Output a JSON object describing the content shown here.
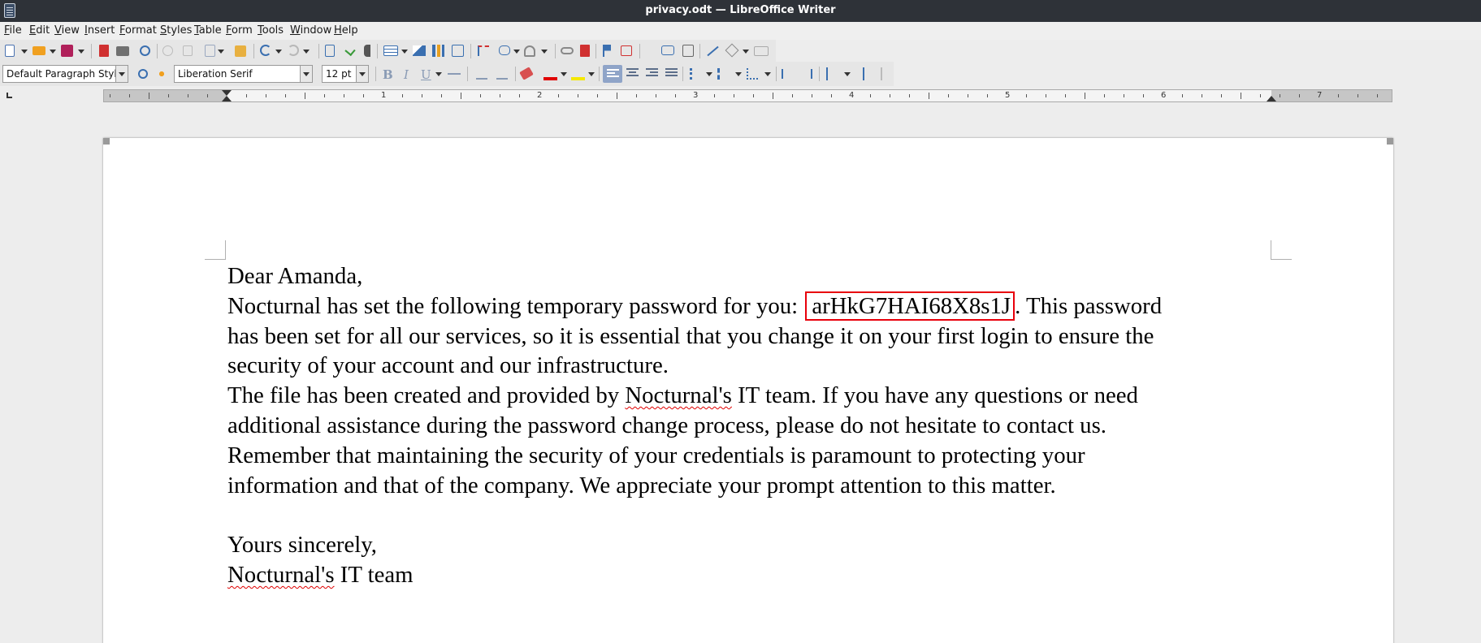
{
  "window": {
    "title": "privacy.odt — LibreOffice Writer"
  },
  "menu": {
    "items": [
      "File",
      "Edit",
      "View",
      "Insert",
      "Format",
      "Styles",
      "Table",
      "Form",
      "Tools",
      "Window",
      "Help"
    ]
  },
  "format_toolbar": {
    "paragraph_style": "Default Paragraph Style",
    "font_name": "Liberation Serif",
    "font_size": "12 pt",
    "bold_label": "B",
    "italic_label": "I",
    "underline_label": "U"
  },
  "ruler": {
    "numbers": [
      "1",
      "2",
      "3",
      "4",
      "5",
      "6",
      "7"
    ]
  },
  "document": {
    "greeting": "Dear Amanda,",
    "p1_before": "Nocturnal has set the following temporary password for you:",
    "password": "arHkG7HAI68X8s1J",
    "p1_after": ". This password",
    "p1_line2": "has been set for all our services, so it is essential that you change it on your first login to ensure the",
    "p1_line3": "security of your account and our infrastructure.",
    "p2_line1_before": "The file has been created and provided by ",
    "p2_line1_word": "Nocturnal's",
    "p2_line1_after": " IT team. If you have any questions or need",
    "p2_line2": "additional assistance during the password change process, please do not hesitate to contact us.",
    "p3_line1": "Remember that maintaining the security of your credentials is paramount to protecting your",
    "p3_line2": "information and that of the company. We appreciate your prompt attention to this matter.",
    "closing": "Yours sincerely,",
    "signature_word": "Nocturnal's",
    "signature_rest": " IT team"
  },
  "colors": {
    "titlebar_bg": "#2e3238",
    "highlight_box": "#e8000b",
    "spellcheck_underline": "#e00000",
    "font_color_swatch": "#e00000",
    "highlight_swatch": "#f5e800"
  },
  "icons": [
    "new-document-icon",
    "open-icon",
    "save-icon",
    "export-pdf-icon",
    "print-icon",
    "print-preview-icon",
    "cut-icon",
    "copy-icon",
    "paste-icon",
    "clone-formatting-icon",
    "undo-icon",
    "redo-icon",
    "find-replace-icon",
    "spellcheck-icon",
    "formatting-marks-icon",
    "insert-table-icon",
    "insert-image-icon",
    "insert-chart-icon",
    "insert-textbox-icon",
    "page-break-icon",
    "insert-field-icon",
    "special-character-icon",
    "hyperlink-icon",
    "footnote-icon",
    "endnote-icon",
    "bookmark-icon",
    "cross-reference-icon",
    "comment-icon",
    "track-changes-icon",
    "line-icon",
    "basic-shapes-icon",
    "draw-functions-icon"
  ]
}
